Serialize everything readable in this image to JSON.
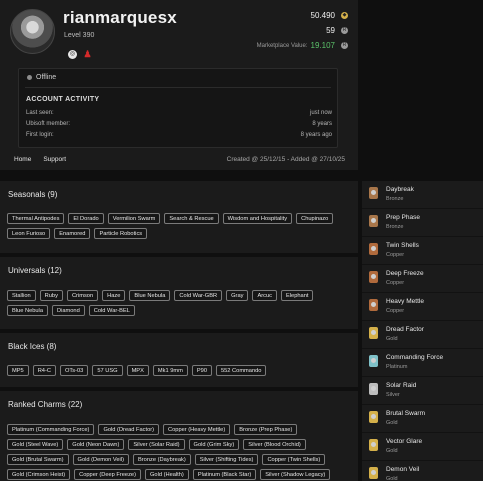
{
  "profile": {
    "username": "rianmarquesx",
    "level": "Level 390",
    "credits": "50.490",
    "renown": "59",
    "marketplace_label": "Marketplace Value:",
    "marketplace_value": "19.107",
    "status": "Offline",
    "activity_title": "ACCOUNT ACTIVITY",
    "activity": [
      {
        "label": "Last seen:",
        "value": "just now"
      },
      {
        "label": "Ubisoft member:",
        "value": "8 years"
      },
      {
        "label": "First login:",
        "value": "8 years ago"
      }
    ],
    "nav": [
      "Home",
      "Support"
    ],
    "created": "Created @ 25/12/15 - Added @ 27/10/25",
    "colors": {
      "marketplace": "#5bc26a",
      "ps_icon": "#d42a2a"
    }
  },
  "sections": [
    {
      "title": "Seasonals (9)",
      "items": [
        "Thermal Antipodes",
        "El Dorado",
        "Vermilion Swarm",
        "Search & Rescue",
        "Wisdom and Hospitality",
        "Chupinazo",
        "Leon Furioso",
        "Enamored",
        "Particle Robotics"
      ]
    },
    {
      "title": "Universals (12)",
      "items": [
        "Stallion",
        "Ruby",
        "Crimson",
        "Haze",
        "Blue Nebula",
        "Cold War-GBR",
        "Gray",
        "Arcuc",
        "Elephant",
        "Blue Nebula",
        "Diamond",
        "Cold War-BEL"
      ]
    },
    {
      "title": "Black Ices (8)",
      "items": [
        "MP5",
        "R4-C",
        "OTs-03",
        "57 USG",
        "MPX",
        "Mk1 9mm",
        "P90",
        "552 Commando"
      ]
    },
    {
      "title": "Ranked Charms (22)",
      "items": [
        "Platinum (Commanding Force)",
        "Gold (Dread Factor)",
        "Copper (Heavy Mettle)",
        "Bronze (Prep Phase)",
        "Gold (Steel Wave)",
        "Gold (Neon Dawn)",
        "Silver (Solar Raid)",
        "Gold (Grim Sky)",
        "Silver (Blood Orchid)",
        "Gold (Brutal Swarm)",
        "Gold (Demon Veil)",
        "Bronze (Daybreak)",
        "Silver (Shifting Tides)",
        "Copper (Twin Shells)",
        "Gold (Crimson Heist)",
        "Copper (Deep Freeze)",
        "Gold (Health)",
        "Platinum (Black Star)",
        "Silver (Shadow Legacy)"
      ]
    }
  ],
  "charms": [
    {
      "name": "Daybreak",
      "tier": "Bronze"
    },
    {
      "name": "Prep Phase",
      "tier": "Bronze"
    },
    {
      "name": "Twin Shells",
      "tier": "Copper"
    },
    {
      "name": "Deep Freeze",
      "tier": "Copper"
    },
    {
      "name": "Heavy Mettle",
      "tier": "Copper"
    },
    {
      "name": "Dread Factor",
      "tier": "Gold"
    },
    {
      "name": "Commanding Force",
      "tier": "Platinum"
    },
    {
      "name": "Solar Raid",
      "tier": "Silver"
    },
    {
      "name": "Brutal Swarm",
      "tier": "Gold"
    },
    {
      "name": "Vector Glare",
      "tier": "Gold"
    },
    {
      "name": "Demon Veil",
      "tier": "Gold"
    }
  ],
  "tier_colors": {
    "Bronze": "#a8764a",
    "Copper": "#b06a3c",
    "Gold": "#d4b04a",
    "Platinum": "#7fc1c8",
    "Silver": "#bdbdbd"
  }
}
